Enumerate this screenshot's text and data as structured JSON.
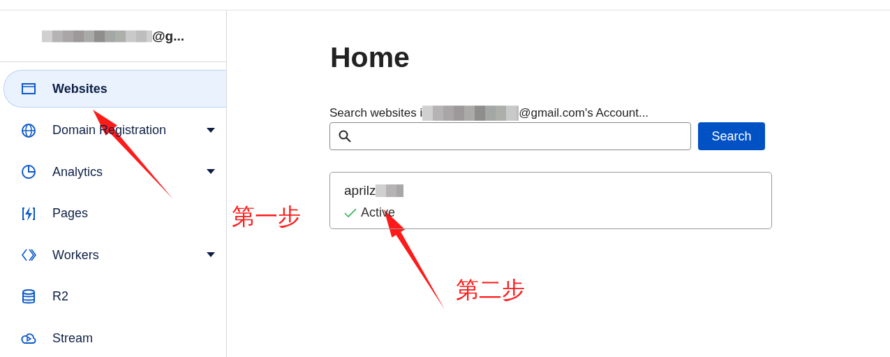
{
  "sidebar": {
    "account": "@g...",
    "items": [
      {
        "label": "Websites",
        "selected": true,
        "has_menu": false
      },
      {
        "label": "Domain Registration",
        "selected": false,
        "has_menu": true
      },
      {
        "label": "Analytics",
        "selected": false,
        "has_menu": true
      },
      {
        "label": "Pages",
        "selected": false,
        "has_menu": false
      },
      {
        "label": "Workers",
        "selected": false,
        "has_menu": true
      },
      {
        "label": "R2",
        "selected": false,
        "has_menu": false
      },
      {
        "label": "Stream",
        "selected": false,
        "has_menu": false
      }
    ]
  },
  "main": {
    "title": "Home",
    "search_label_start": "Search websites i",
    "search_label_end": "@gmail.com's Account...",
    "search_button": "Search",
    "sites": [
      {
        "name": "aprilz",
        "status": "Active",
        "active": true
      }
    ]
  },
  "annotations": [
    {
      "label": "第一步"
    },
    {
      "label": "第二步"
    }
  ]
}
